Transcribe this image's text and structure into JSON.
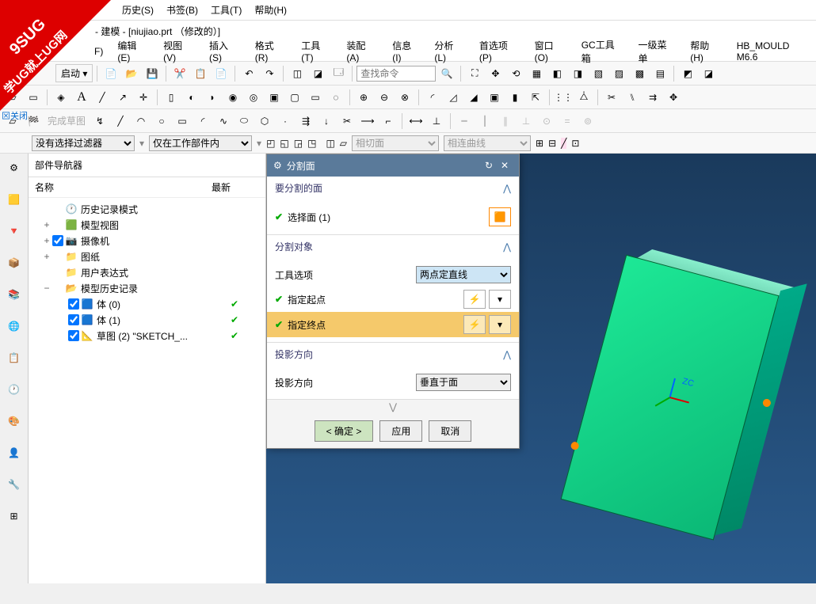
{
  "watermark": {
    "line1": "9SUG",
    "line2": "学UG就上UG网"
  },
  "closelink": "⊠关闭",
  "title": " - 建模 - [niujiao.prt （修改的）]",
  "menu1": [
    "历史(S)",
    "书签(B)",
    "工具(T)",
    "帮助(H)"
  ],
  "menu2": [
    "F)",
    "编辑(E)",
    "视图(V)",
    "插入(S)",
    "格式(R)",
    "工具(T)",
    "装配(A)",
    "信息(I)",
    "分析(L)",
    "首选项(P)",
    "窗口(O)",
    "GC工具箱",
    "一级菜单",
    "帮助(H)",
    "HB_MOULD M6.6"
  ],
  "start_label": "启动",
  "search_placeholder": "查找命令",
  "filter1": "没有选择过滤器",
  "filter2": "仅在工作部件内",
  "filter3": "相切面",
  "filter4": "相连曲线",
  "nav": {
    "title": "部件导航器",
    "col1": "名称",
    "col2": "最新",
    "items": [
      {
        "indent": 0,
        "exp": "",
        "chk": false,
        "icon": "clock",
        "label": "历史记录模式",
        "latest": ""
      },
      {
        "indent": 0,
        "exp": "+",
        "chk": false,
        "icon": "cube",
        "label": "模型视图",
        "latest": ""
      },
      {
        "indent": 0,
        "exp": "+",
        "chk": true,
        "icon": "camera",
        "label": "摄像机",
        "latest": ""
      },
      {
        "indent": 0,
        "exp": "+",
        "chk": false,
        "icon": "folder",
        "label": "图纸",
        "latest": ""
      },
      {
        "indent": 0,
        "exp": "",
        "chk": false,
        "icon": "folder",
        "label": "用户表达式",
        "latest": ""
      },
      {
        "indent": 0,
        "exp": "−",
        "chk": false,
        "icon": "folder-open",
        "label": "模型历史记录",
        "latest": ""
      },
      {
        "indent": 1,
        "exp": "",
        "chk": true,
        "icon": "body",
        "label": "体 (0)",
        "latest": "✔"
      },
      {
        "indent": 1,
        "exp": "",
        "chk": true,
        "icon": "body",
        "label": "体 (1)",
        "latest": "✔"
      },
      {
        "indent": 1,
        "exp": "",
        "chk": true,
        "icon": "sketch",
        "label": "草图 (2) \"SKETCH_...",
        "latest": "✔"
      }
    ]
  },
  "dialog": {
    "title": "分割面",
    "sec1": {
      "title": "要分割的面",
      "row1": "选择面 (1)"
    },
    "sec2": {
      "title": "分割对象",
      "opt_label": "工具选项",
      "opt_value": "两点定直线",
      "row_start": "指定起点",
      "row_end": "指定终点"
    },
    "sec3": {
      "title": "投影方向",
      "label": "投影方向",
      "value": "垂直于面"
    },
    "ok": "< 确定 >",
    "apply": "应用",
    "cancel": "取消"
  },
  "axis_z": "ZC"
}
